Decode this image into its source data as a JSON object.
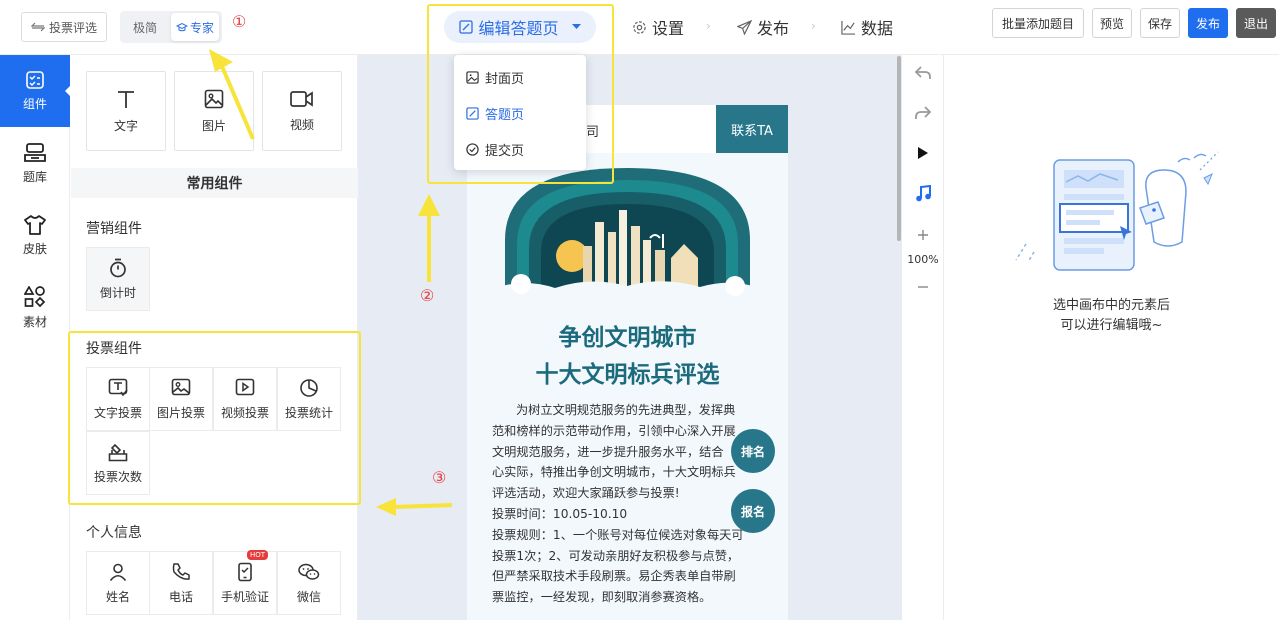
{
  "topbar": {
    "back_label": "投票评选",
    "mode_simple": "极简",
    "mode_expert": "专家",
    "nav_edit": "编辑答题页",
    "nav_settings": "设置",
    "nav_publish": "发布",
    "nav_data": "数据",
    "btn_bulk_add": "批量添加题目",
    "btn_preview": "预览",
    "btn_save": "保存",
    "btn_publish": "发布",
    "btn_exit": "退出"
  },
  "annotations": {
    "n1": "①",
    "n2": "②",
    "n3": "③",
    "highlight_color": "#f7e33a",
    "number_color": "#e63c3c"
  },
  "dropdown": {
    "items": [
      {
        "label": "封面页",
        "icon": "image-icon"
      },
      {
        "label": "答题页",
        "icon": "edit-image-icon"
      },
      {
        "label": "提交页",
        "icon": "check-circle-icon"
      }
    ]
  },
  "rail": {
    "items": [
      {
        "label": "组件",
        "icon": "component-icon"
      },
      {
        "label": "题库",
        "icon": "question-bank-icon"
      },
      {
        "label": "皮肤",
        "icon": "tshirt-icon"
      },
      {
        "label": "素材",
        "icon": "shapes-icon"
      }
    ]
  },
  "panel": {
    "basic": [
      {
        "label": "文字",
        "icon": "text-icon"
      },
      {
        "label": "图片",
        "icon": "image-icon"
      },
      {
        "label": "视频",
        "icon": "video-icon"
      }
    ],
    "section_common": "常用组件",
    "marketing": {
      "title": "营销组件",
      "items": [
        {
          "label": "倒计时",
          "icon": "stopwatch-icon"
        }
      ]
    },
    "vote": {
      "title": "投票组件",
      "items": [
        {
          "label": "文字投票",
          "icon": "text-vote-icon"
        },
        {
          "label": "图片投票",
          "icon": "image-vote-icon"
        },
        {
          "label": "视频投票",
          "icon": "video-vote-icon"
        },
        {
          "label": "投票统计",
          "icon": "pie-chart-icon"
        },
        {
          "label": "投票次数",
          "icon": "ballot-box-icon"
        }
      ]
    },
    "personal": {
      "title": "个人信息",
      "items": [
        {
          "label": "姓名",
          "icon": "user-icon"
        },
        {
          "label": "电话",
          "icon": "phone-icon"
        },
        {
          "label": "手机验证",
          "icon": "mobile-verify-icon",
          "badge": "HOT"
        },
        {
          "label": "微信",
          "icon": "wechat-icon"
        }
      ]
    }
  },
  "canvas": {
    "company": "限公司",
    "contact_btn": "联系TA",
    "title_line1": "争创文明城市",
    "title_line2": "十大文明标兵评选",
    "para_lines": [
      "为树立文明规范服务的先进典型，发挥典",
      "范和榜样的示范带动作用，引领中心深入开展",
      "文明规范服务，进一步提升服务水平，结合",
      "心实际，特推出争创文明城市，十大文明标兵",
      "评选活动，欢迎大家踊跃参与投票!",
      "投票时间：10.05-10.10",
      "投票规则：1、一个账号对每位候选对象每天可",
      "投票1次；2、可发动亲朋好友积极参与点赞，",
      "但严禁采取技术手段刷票。易企秀表单自带刷",
      "票监控，一经发现，即刻取消参赛资格。"
    ],
    "float_rank": "排名",
    "float_signup": "报名",
    "accent_color": "#27768a"
  },
  "tools": {
    "zoom": "100%"
  },
  "right_panel": {
    "hint_line1": "选中画布中的元素后",
    "hint_line2": "可以进行编辑哦~"
  }
}
